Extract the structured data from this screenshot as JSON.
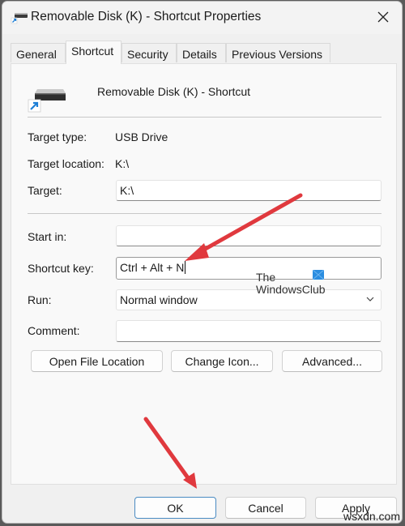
{
  "window": {
    "title": "Removable Disk (K) - Shortcut Properties",
    "close_icon": "close-icon"
  },
  "tabs": [
    {
      "label": "General",
      "active": false
    },
    {
      "label": "Shortcut",
      "active": true
    },
    {
      "label": "Security",
      "active": false
    },
    {
      "label": "Details",
      "active": false
    },
    {
      "label": "Previous Versions",
      "active": false
    }
  ],
  "header": {
    "icon": "removable-drive-shortcut-icon",
    "name": "Removable Disk (K) - Shortcut"
  },
  "info": {
    "target_type_label": "Target type:",
    "target_type_value": "USB Drive",
    "target_location_label": "Target location:",
    "target_location_value": "K:\\"
  },
  "fields": {
    "target_label": "Target:",
    "target_value": "K:\\",
    "start_in_label": "Start in:",
    "start_in_value": "",
    "shortcut_key_label": "Shortcut key:",
    "shortcut_key_value": "Ctrl + Alt + N",
    "run_label": "Run:",
    "run_value": "Normal window",
    "comment_label": "Comment:",
    "comment_value": ""
  },
  "actions": {
    "open_file_location": "Open File Location",
    "change_icon": "Change Icon...",
    "advanced": "Advanced..."
  },
  "footer": {
    "ok": "OK",
    "cancel": "Cancel",
    "apply": "Apply"
  },
  "watermark": {
    "line1": "The",
    "line2": "WindowsClub",
    "site": "wsxdn.com"
  },
  "annotations": {
    "arrow_color": "#e0393e"
  }
}
